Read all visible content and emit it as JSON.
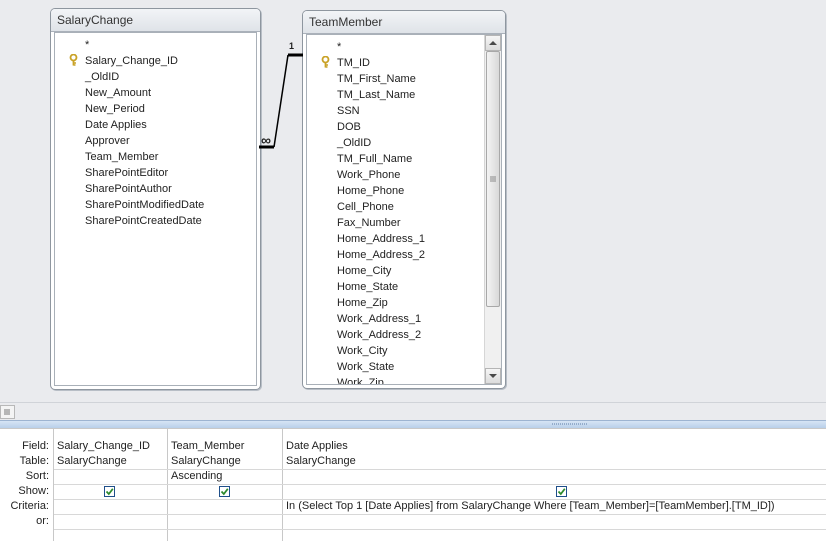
{
  "tables": {
    "salary_change": {
      "title": "SalaryChange",
      "fields": [
        "*",
        "Salary_Change_ID",
        "_OldID",
        "New_Amount",
        "New_Period",
        "Date Applies",
        "Approver",
        "Team_Member",
        "SharePointEditor",
        "SharePointAuthor",
        "SharePointModifiedDate",
        "SharePointCreatedDate"
      ]
    },
    "team_member": {
      "title": "TeamMember",
      "fields": [
        "*",
        "TM_ID",
        "TM_First_Name",
        "TM_Last_Name",
        "SSN",
        "DOB",
        "_OldID",
        "TM_Full_Name",
        "Work_Phone",
        "Home_Phone",
        "Cell_Phone",
        "Fax_Number",
        "Home_Address_1",
        "Home_Address_2",
        "Home_City",
        "Home_State",
        "Home_Zip",
        "Work_Address_1",
        "Work_Address_2",
        "Work_City",
        "Work_State",
        "Work_Zip"
      ]
    }
  },
  "relationship": {
    "one_label": "1",
    "many_label": "∞"
  },
  "grid": {
    "row_labels": {
      "field": "Field:",
      "table": "Table:",
      "sort": "Sort:",
      "show": "Show:",
      "criteria": "Criteria:",
      "or": "or:"
    },
    "columns": [
      {
        "field": "Salary_Change_ID",
        "table": "SalaryChange",
        "sort": "",
        "show": true,
        "criteria": ""
      },
      {
        "field": "Team_Member",
        "table": "SalaryChange",
        "sort": "Ascending",
        "show": true,
        "criteria": ""
      },
      {
        "field": "Date Applies",
        "table": "SalaryChange",
        "sort": "",
        "show": true,
        "criteria": "In (Select Top 1 [Date Applies] from SalaryChange Where [Team_Member]=[TeamMember].[TM_ID])"
      }
    ]
  },
  "icons": {
    "key": "key-icon",
    "checkbox": "checkbox-icon",
    "scroll_up": "up-arrow-icon",
    "scroll_down": "down-arrow-icon"
  },
  "colors": {
    "key_gold": "#c9a227",
    "check_green": "#2e8b2e",
    "splitter_blue": "#b9cfe9"
  }
}
